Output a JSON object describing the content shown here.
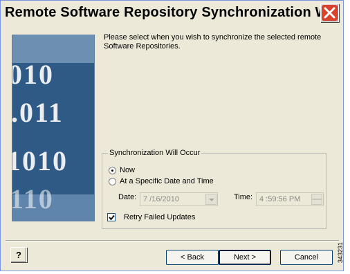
{
  "window": {
    "title": "Remote Software Repository Synchronization W...",
    "close_icon": "close-icon"
  },
  "intro_text": "Please select when you wish to synchronize the selected remote Software Repositories.",
  "sync_group": {
    "legend": "Synchronization Will Occur",
    "option_now": "Now",
    "option_specific": "At a Specific Date and Time",
    "selected": "Now",
    "date_label": "Date:",
    "date_value": "7 /16/2010",
    "time_label": "Time:",
    "time_value": "4 :59:56 PM",
    "retry_label": "Retry Failed Updates",
    "retry_checked": true
  },
  "buttons": {
    "help_glyph": "?",
    "back": "< Back",
    "next": "Next >",
    "cancel": "Cancel"
  },
  "figure_code": "343231",
  "colors": {
    "dialog_bg": "#ece9d8",
    "close_red": "#d9432b",
    "button_border": "#003c74"
  }
}
